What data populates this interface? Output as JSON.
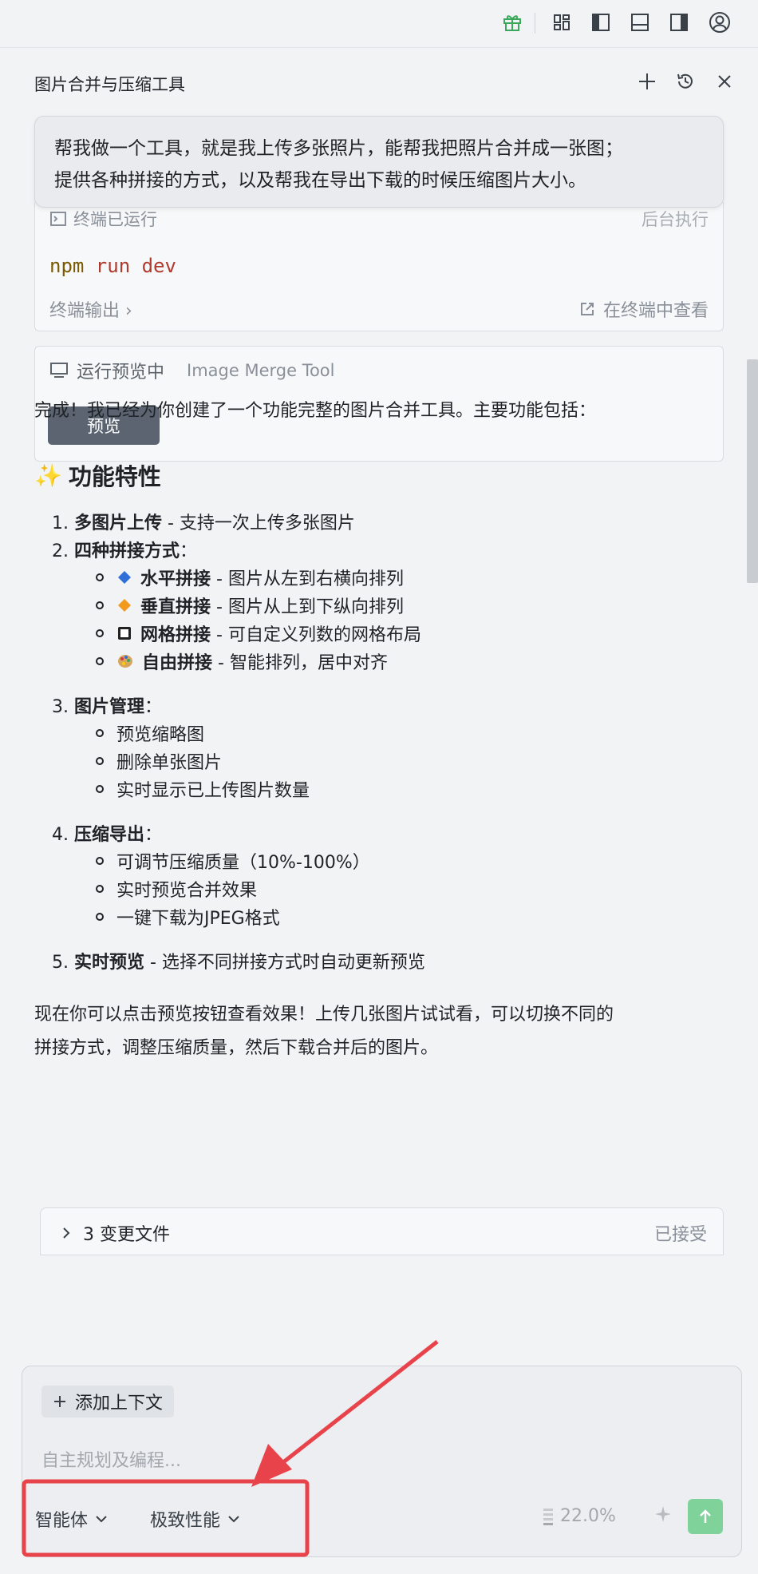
{
  "topbar": {
    "icons": [
      "gift-icon",
      "layout-grid-icon",
      "panel-left-icon",
      "panel-bottom-icon",
      "panel-right-icon",
      "user-icon"
    ]
  },
  "panel": {
    "title": "图片合并与压缩工具",
    "actions": [
      "plus-icon",
      "history-icon",
      "close-icon"
    ]
  },
  "user_message": {
    "line1": "帮我做一个工具，就是我上传多张照片，能帮我把照片合并成一张图；",
    "line2": "提供各种拼接的方式，以及帮我在导出下载的时候压缩图片大小。"
  },
  "terminal": {
    "header": "终端已运行",
    "status": "后台执行",
    "cmd_npm": "npm",
    "cmd_rest": " run dev",
    "output_label": "终端输出 ›",
    "view_label": "在终端中查看"
  },
  "preview": {
    "status": "运行预览中",
    "app_name": "Image Merge Tool",
    "button": "预览"
  },
  "content": {
    "intro": "完成！我已经为你创建了一个功能完整的图片合并工具。主要功能包括：",
    "heading": "功能特性",
    "items": {
      "i1_bold": "多图片上传",
      "i1_rest": " - 支持一次上传多张图片",
      "i2_bold": "四种拼接方式",
      "i2_rest": "：",
      "s1_bold": "水平拼接",
      "s1_rest": " - 图片从左到右横向排列",
      "s2_bold": "垂直拼接",
      "s2_rest": " - 图片从上到下纵向排列",
      "s3_bold": "网格拼接",
      "s3_rest": " - 可自定义列数的网格布局",
      "s4_bold": "自由拼接",
      "s4_rest": " - 智能排列，居中对齐",
      "i3_bold": "图片管理",
      "i3_rest": "：",
      "m1": "预览缩略图",
      "m2": "删除单张图片",
      "m3": "实时显示已上传图片数量",
      "i4_bold": "压缩导出",
      "i4_rest": "：",
      "e1": "可调节压缩质量（10%-100%）",
      "e2": "实时预览合并效果",
      "e3": "一键下载为JPEG格式",
      "i5_bold": "实时预览",
      "i5_rest": " - 选择不同拼接方式时自动更新预览"
    },
    "outro1": "现在你可以点击预览按钮查看效果！上传几张图片试试看，可以切换不同的",
    "outro2": "拼接方式，调整压缩质量，然后下载合并后的图片。"
  },
  "changes": {
    "label": "3 变更文件",
    "status": "已接受"
  },
  "input": {
    "add_context": "添加上下文",
    "placeholder": "自主规划及编程...",
    "mode_agent": "智能体",
    "mode_perf": "极致性能",
    "usage": "22.0%"
  },
  "colors": {
    "send_bg": "#7ed29a",
    "annotation": "#e8434a"
  }
}
